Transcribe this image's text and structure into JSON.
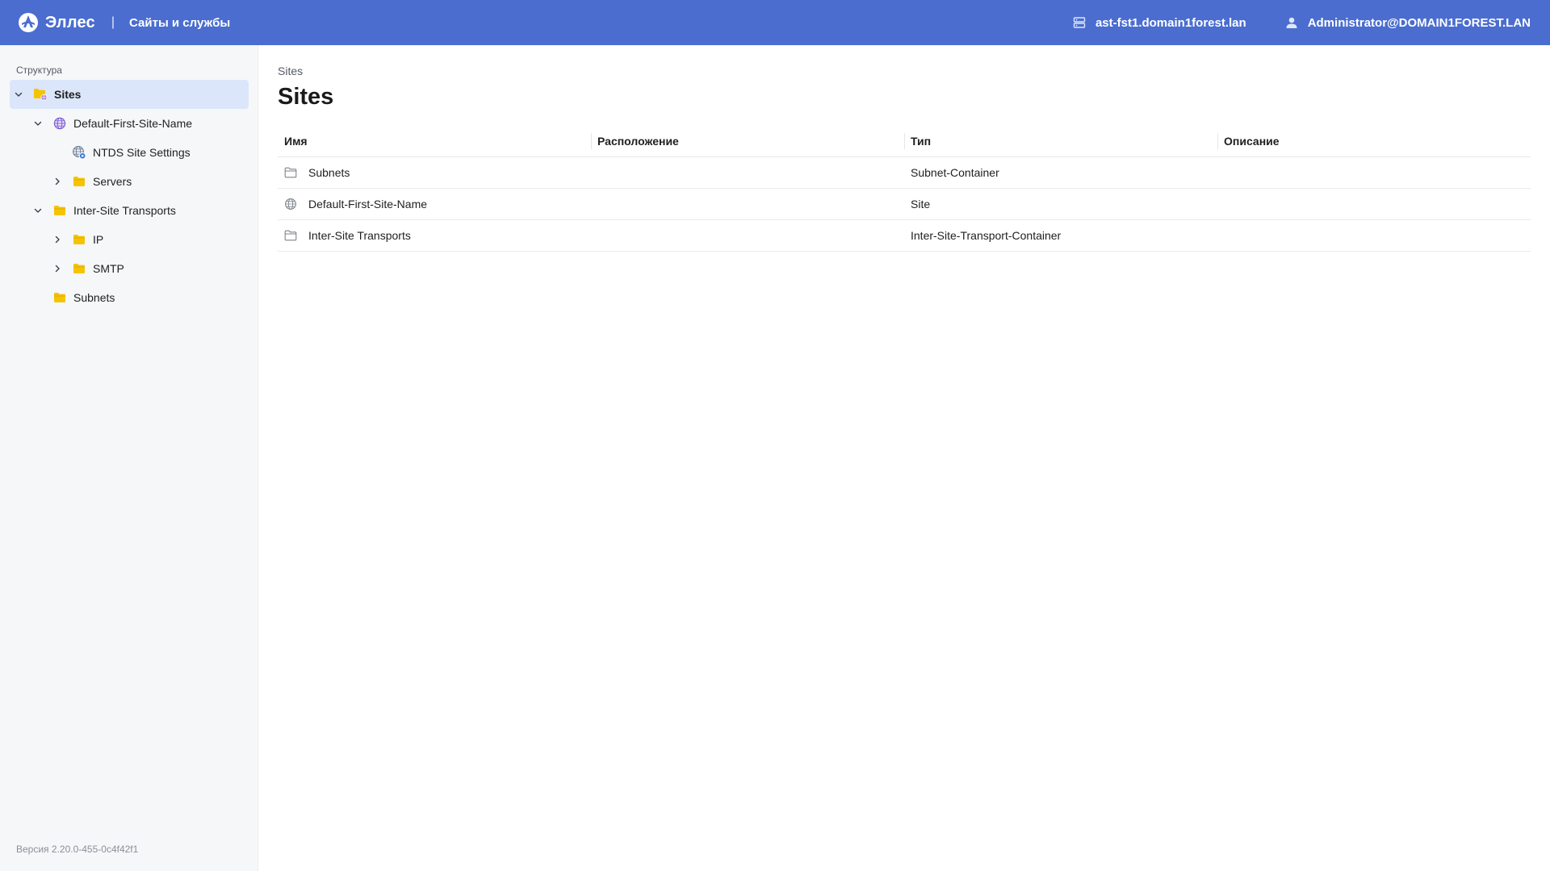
{
  "header": {
    "brand_name": "Эллес",
    "separator": "|",
    "app_title": "Сайты и службы",
    "server": "ast-fst1.domain1forest.lan",
    "user": "Administrator@DOMAIN1FOREST.LAN"
  },
  "sidebar": {
    "caption": "Структура",
    "tree": [
      {
        "label": "Sites",
        "level": 0,
        "expander": "expanded",
        "icon": "sites-folder-icon",
        "selected": true
      },
      {
        "label": "Default-First-Site-Name",
        "level": 1,
        "expander": "expanded",
        "icon": "globe-icon",
        "selected": false
      },
      {
        "label": "NTDS Site Settings",
        "level": 2,
        "expander": "none",
        "icon": "settings-globe-icon",
        "selected": false
      },
      {
        "label": "Servers",
        "level": 2,
        "expander": "collapsed",
        "icon": "folder-icon",
        "selected": false
      },
      {
        "label": "Inter-Site Transports",
        "level": 1,
        "expander": "expanded",
        "icon": "folder-icon",
        "selected": false
      },
      {
        "label": "IP",
        "level": 2,
        "expander": "collapsed",
        "icon": "folder-icon",
        "selected": false
      },
      {
        "label": "SMTP",
        "level": 2,
        "expander": "collapsed",
        "icon": "folder-icon",
        "selected": false
      },
      {
        "label": "Subnets",
        "level": 1,
        "expander": "none",
        "icon": "folder-icon",
        "selected": false
      }
    ],
    "version": "Версия 2.20.0-455-0c4f42f1"
  },
  "main": {
    "breadcrumb": "Sites",
    "title": "Sites",
    "columns": [
      "Имя",
      "Расположение",
      "Тип",
      "Описание"
    ],
    "rows": [
      {
        "icon": "folder-outline-icon",
        "name": "Subnets",
        "location": "",
        "type": "Subnet-Container",
        "description": ""
      },
      {
        "icon": "globe-outline-icon",
        "name": "Default-First-Site-Name",
        "location": "",
        "type": "Site",
        "description": ""
      },
      {
        "icon": "folder-outline-icon",
        "name": "Inter-Site Transports",
        "location": "",
        "type": "Inter-Site-Transport-Container",
        "description": ""
      }
    ]
  },
  "colors": {
    "header_bg": "#4a6dcf",
    "sidebar_bg": "#f6f7f9",
    "selected_bg": "#dbe6fb",
    "folder_yellow": "#f5c400",
    "globe_purple": "#7b5cd6"
  }
}
